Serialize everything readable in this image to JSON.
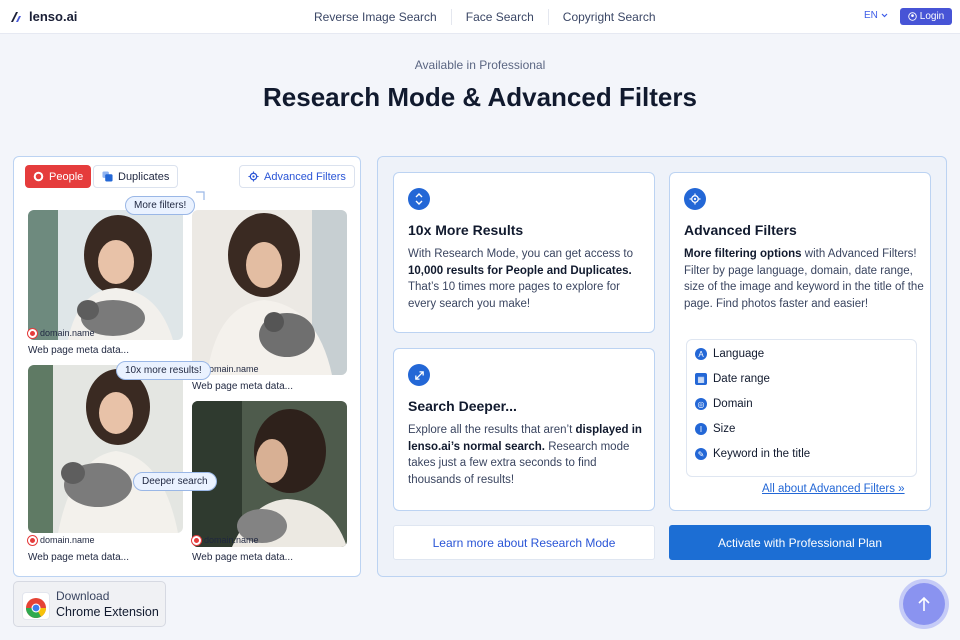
{
  "header": {
    "logo_text": "lenso.ai",
    "nav": [
      "Reverse Image Search",
      "Face Search",
      "Copyright Search"
    ],
    "language": "EN",
    "login_label": "Login"
  },
  "hero": {
    "eyebrow": "Available in Professional",
    "title": "Research Mode & Advanced Filters"
  },
  "results_demo": {
    "chips": {
      "people": "People",
      "duplicates": "Duplicates",
      "advanced": "Advanced Filters"
    },
    "results": [
      {
        "domain": "domain.name",
        "meta": "Web page meta data..."
      },
      {
        "domain": "domain.name",
        "meta": "Web page meta data..."
      },
      {
        "domain": "domain.name",
        "meta": "Web page meta data..."
      },
      {
        "domain": "domain.name",
        "meta": "Web page meta data..."
      }
    ],
    "bubbles": {
      "more_filters": "More filters!",
      "more_results": "10x more results!",
      "deeper": "Deeper search"
    }
  },
  "features": {
    "more_results": {
      "title": "10x More Results",
      "p1": "With Research Mode, you can get access to ",
      "b1": "10,000 results for People and Duplicates.",
      "p2": " That’s 10 times more pages to explore for every search you make!"
    },
    "deeper": {
      "title": "Search Deeper...",
      "p1": "Explore all the results that aren’t ",
      "b1": "displayed in lenso.ai’s normal search.",
      "p2": " Research mode takes just a few extra seconds to find thousands of results!"
    },
    "advanced": {
      "title": "Advanced Filters",
      "b1": "More filtering options",
      "p1": " with Advanced Filters! Filter by page language, domain, date range, size of the image and keyword in the title of the page. Find photos faster and easier!",
      "filters": [
        "Language",
        "Date range",
        "Domain",
        "Size",
        "Keyword in the title"
      ],
      "link": "All about Advanced Filters »"
    }
  },
  "actions": {
    "learn_more": "Learn more about Research Mode",
    "activate": "Activate with Professional Plan"
  },
  "chrome_extension": {
    "line1": "Download",
    "line2": "Chrome Extension"
  },
  "colors": {
    "primary": "#1c6ed4",
    "people_chip": "#e53c3c",
    "accent": "#4754d6"
  }
}
